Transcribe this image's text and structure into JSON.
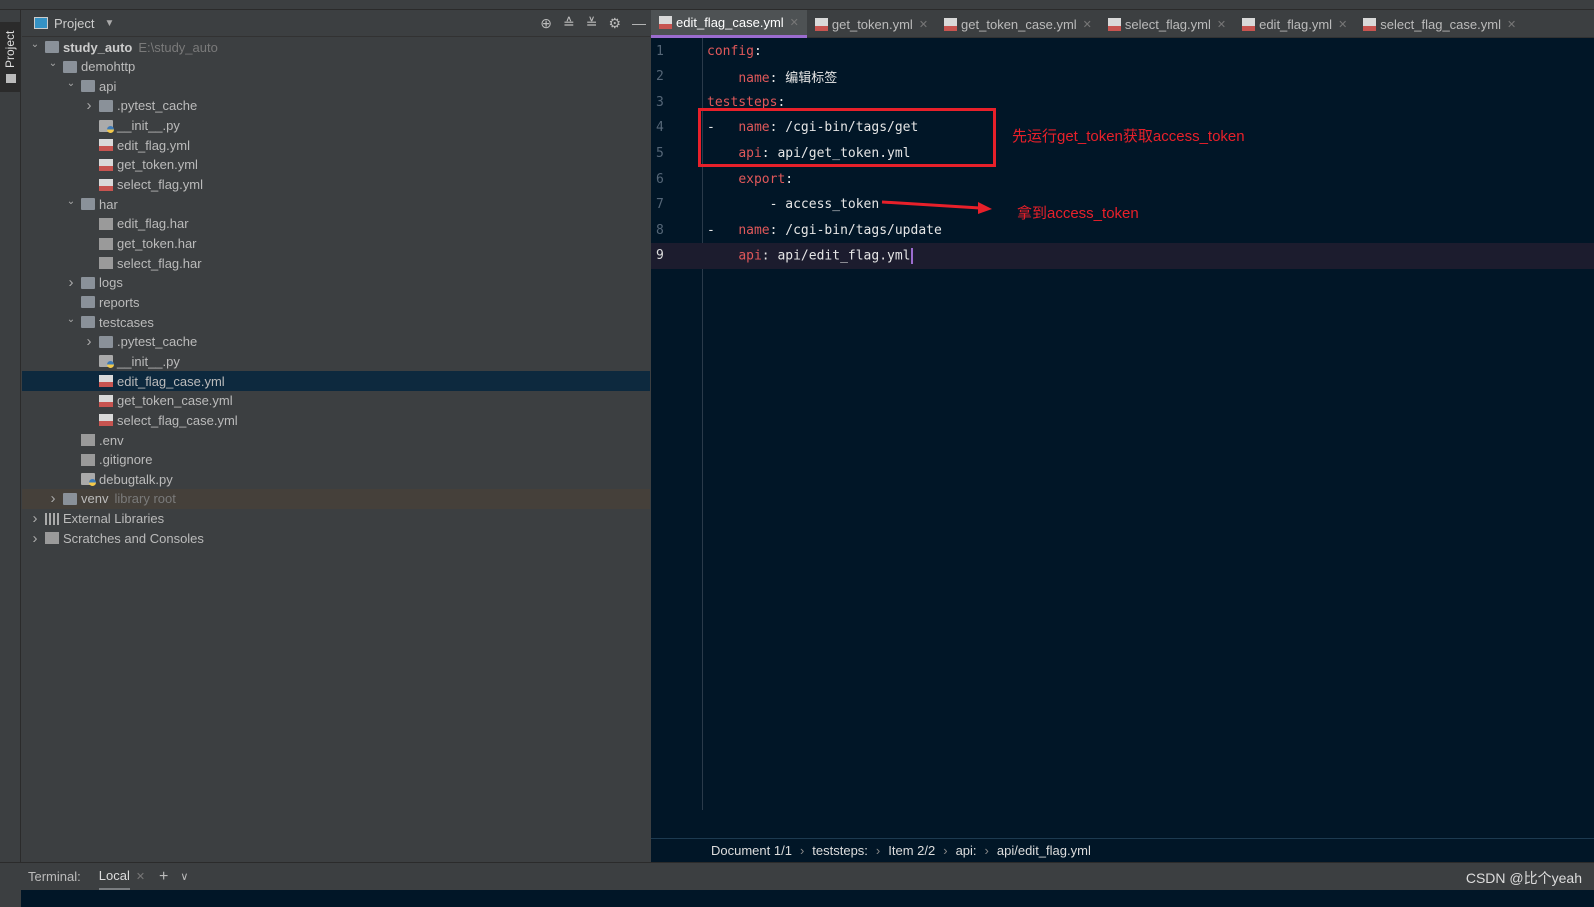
{
  "sidebar_tab": "Project",
  "project_panel": {
    "title": "Project",
    "tools": [
      "locate-icon",
      "expand-all-icon",
      "collapse-all-icon",
      "gear-icon",
      "minimize-icon"
    ],
    "tree": [
      {
        "label": "study_auto",
        "hint": "E:\\study_auto",
        "level": 0,
        "type": "folder",
        "expanded": true,
        "bold": true
      },
      {
        "label": "demohttp",
        "level": 1,
        "type": "folder",
        "expanded": true
      },
      {
        "label": "api",
        "level": 2,
        "type": "folder",
        "expanded": true
      },
      {
        "label": ".pytest_cache",
        "level": 3,
        "type": "folder",
        "expanded": false
      },
      {
        "label": "__init__.py",
        "level": 3,
        "type": "py"
      },
      {
        "label": "edit_flag.yml",
        "level": 3,
        "type": "yml"
      },
      {
        "label": "get_token.yml",
        "level": 3,
        "type": "yml"
      },
      {
        "label": "select_flag.yml",
        "level": 3,
        "type": "yml"
      },
      {
        "label": "har",
        "level": 2,
        "type": "folder",
        "expanded": true
      },
      {
        "label": "edit_flag.har",
        "level": 3,
        "type": "har"
      },
      {
        "label": "get_token.har",
        "level": 3,
        "type": "har"
      },
      {
        "label": "select_flag.har",
        "level": 3,
        "type": "har"
      },
      {
        "label": "logs",
        "level": 2,
        "type": "folder",
        "expanded": false
      },
      {
        "label": "reports",
        "level": 2,
        "type": "folder"
      },
      {
        "label": "testcases",
        "level": 2,
        "type": "folder",
        "expanded": true
      },
      {
        "label": ".pytest_cache",
        "level": 3,
        "type": "folder",
        "expanded": false
      },
      {
        "label": "__init__.py",
        "level": 3,
        "type": "py"
      },
      {
        "label": "edit_flag_case.yml",
        "level": 3,
        "type": "yml",
        "selected": true
      },
      {
        "label": "get_token_case.yml",
        "level": 3,
        "type": "yml"
      },
      {
        "label": "select_flag_case.yml",
        "level": 3,
        "type": "yml"
      },
      {
        "label": ".env",
        "level": 2,
        "type": "file"
      },
      {
        "label": ".gitignore",
        "level": 2,
        "type": "file"
      },
      {
        "label": "debugtalk.py",
        "level": 2,
        "type": "py"
      },
      {
        "label": "venv",
        "hint": "library root",
        "level": 1,
        "type": "folder",
        "expanded": false,
        "venv": true
      },
      {
        "label": "External Libraries",
        "level": 0,
        "type": "lib",
        "expanded": false
      },
      {
        "label": "Scratches and Consoles",
        "level": 0,
        "type": "file",
        "expanded": false
      }
    ]
  },
  "editor": {
    "tabs": [
      {
        "label": "edit_flag_case.yml",
        "active": true
      },
      {
        "label": "get_token.yml"
      },
      {
        "label": "get_token_case.yml"
      },
      {
        "label": "select_flag.yml"
      },
      {
        "label": "edit_flag.yml"
      },
      {
        "label": "select_flag_case.yml"
      }
    ],
    "lines": [
      {
        "n": "1",
        "key": "config",
        "pre": "",
        "val": ""
      },
      {
        "n": "2",
        "key": "name",
        "pre": "    ",
        "val": "编辑标签"
      },
      {
        "n": "3",
        "key": "teststeps",
        "pre": "",
        "val": ""
      },
      {
        "n": "4",
        "key": "name",
        "pre": "-   ",
        "val": "/cgi-bin/tags/get"
      },
      {
        "n": "5",
        "key": "api",
        "pre": "    ",
        "val": "api/get_token.yml"
      },
      {
        "n": "6",
        "key": "export",
        "pre": "    ",
        "val": ""
      },
      {
        "n": "7",
        "key": "",
        "pre": "        - ",
        "val": "access_token"
      },
      {
        "n": "8",
        "key": "name",
        "pre": "-   ",
        "val": "/cgi-bin/tags/update"
      },
      {
        "n": "9",
        "key": "api",
        "pre": "    ",
        "val": "api/edit_flag.yml",
        "current": true
      }
    ],
    "annotations": {
      "box_note": "先运行get_token获取access_token",
      "arrow_note": "拿到access_token",
      "color": "#e8202a"
    },
    "breadcrumb": [
      "Document 1/1",
      "teststeps:",
      "Item 2/2",
      "api:",
      "api/edit_flag.yml"
    ]
  },
  "bottom": {
    "terminal_label": "Terminal:",
    "local_tab": "Local",
    "watermark": "CSDN @比个yeah"
  }
}
